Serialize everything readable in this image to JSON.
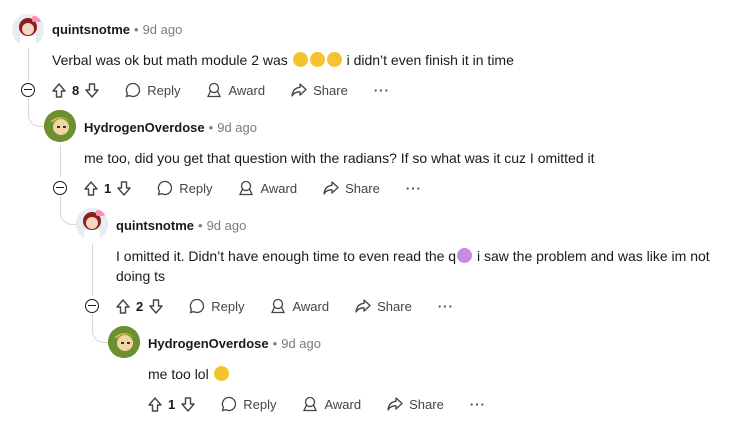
{
  "comments": [
    {
      "author": "quintsnotme",
      "time": "9d ago",
      "text_before": "Verbal was ok but math module 2 was",
      "text_after": "i didn’t even finish it in time",
      "votes": "8",
      "reply": "Reply",
      "award": "Award",
      "share": "Share"
    },
    {
      "author": "HydrogenOverdose",
      "time": "9d ago",
      "text": "me too, did you get that question with the radians? If so what was it cuz I omitted it",
      "votes": "1",
      "reply": "Reply",
      "award": "Award",
      "share": "Share"
    },
    {
      "author": "quintsnotme",
      "time": "9d ago",
      "text_line1_before": "I omitted it. Didn’t have enough time to even read the q",
      "text_line1_after": "i saw the problem and was like im not",
      "text_line2": "doing ts",
      "votes": "2",
      "reply": "Reply",
      "award": "Award",
      "share": "Share"
    },
    {
      "author": "HydrogenOverdose",
      "time": "9d ago",
      "text": "me too lol",
      "votes": "1",
      "reply": "Reply",
      "award": "Award",
      "share": "Share"
    }
  ],
  "separator": "•",
  "more": "···",
  "icons": {
    "upvote": "arrow-up-icon",
    "downvote": "arrow-down-icon",
    "reply": "speech-bubble-icon",
    "award": "award-icon",
    "share": "share-arrow-icon",
    "collapse": "minus-circle-icon"
  },
  "colors": {
    "meta": "#7c7c7c",
    "text": "#1a1a1b",
    "thread": "#d6d6d6",
    "emoji": "#f4c430"
  }
}
